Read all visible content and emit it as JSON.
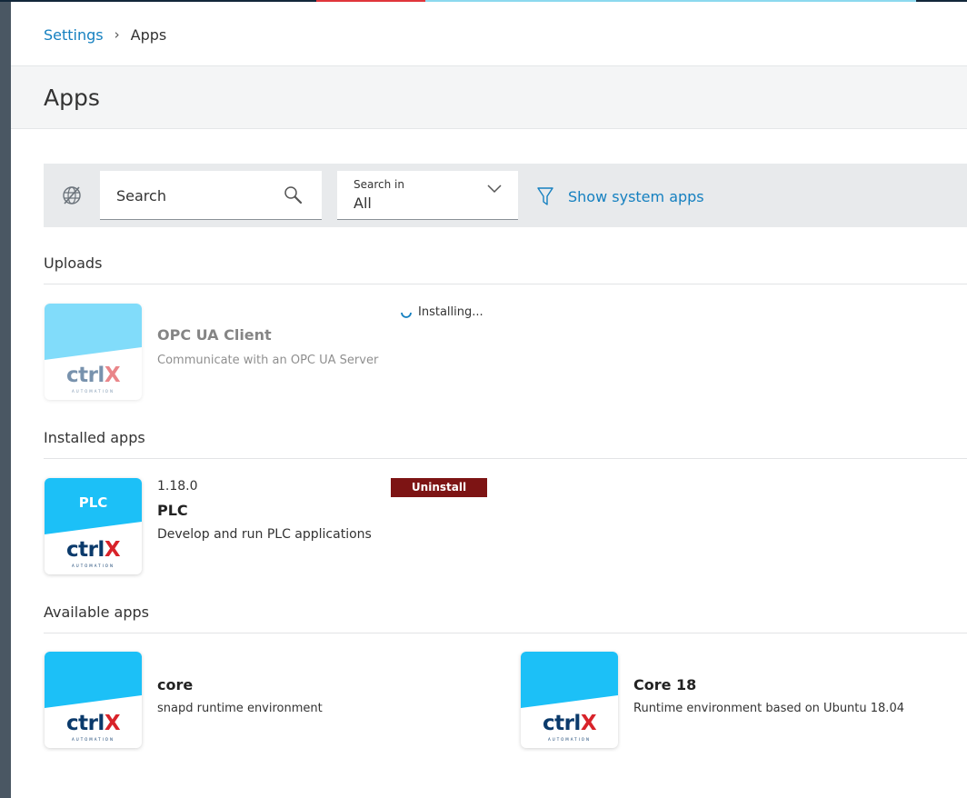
{
  "breadcrumb": {
    "parent": "Settings",
    "separator": "›",
    "current": "Apps"
  },
  "page": {
    "title": "Apps"
  },
  "toolbar": {
    "globe_icon": "globe-crossed-icon",
    "search": {
      "placeholder": "Search",
      "value": ""
    },
    "search_in": {
      "label": "Search in",
      "value": "All"
    },
    "filter_label": "Show system apps"
  },
  "sections": {
    "uploads": "Uploads",
    "installed": "Installed apps",
    "available": "Available apps"
  },
  "uploads": [
    {
      "name": "OPC UA Client",
      "description": "Communicate with an OPC UA Server",
      "status": "Installing...",
      "tile_text": ""
    }
  ],
  "installed": [
    {
      "version": "1.18.0",
      "name": "PLC",
      "description": "Develop and run PLC applications",
      "tile_text": "PLC",
      "action": "Uninstall"
    }
  ],
  "available": [
    {
      "name": "core",
      "description": "snapd runtime environment",
      "tile_text": ""
    },
    {
      "name": "Core 18",
      "description": "Runtime environment based on Ubuntu 18.04",
      "tile_text": ""
    }
  ],
  "logo": {
    "part1": "ctrl",
    "part2": "X",
    "sub": "AUTOMATION"
  },
  "colors": {
    "accent": "#1580c0",
    "tile_blue": "#1cc0f7",
    "tile_blue_faded": "#7ddbf8",
    "uninstall": "#7d1414",
    "logo_navy": "#0b3a6b",
    "logo_red": "#d8232a"
  }
}
